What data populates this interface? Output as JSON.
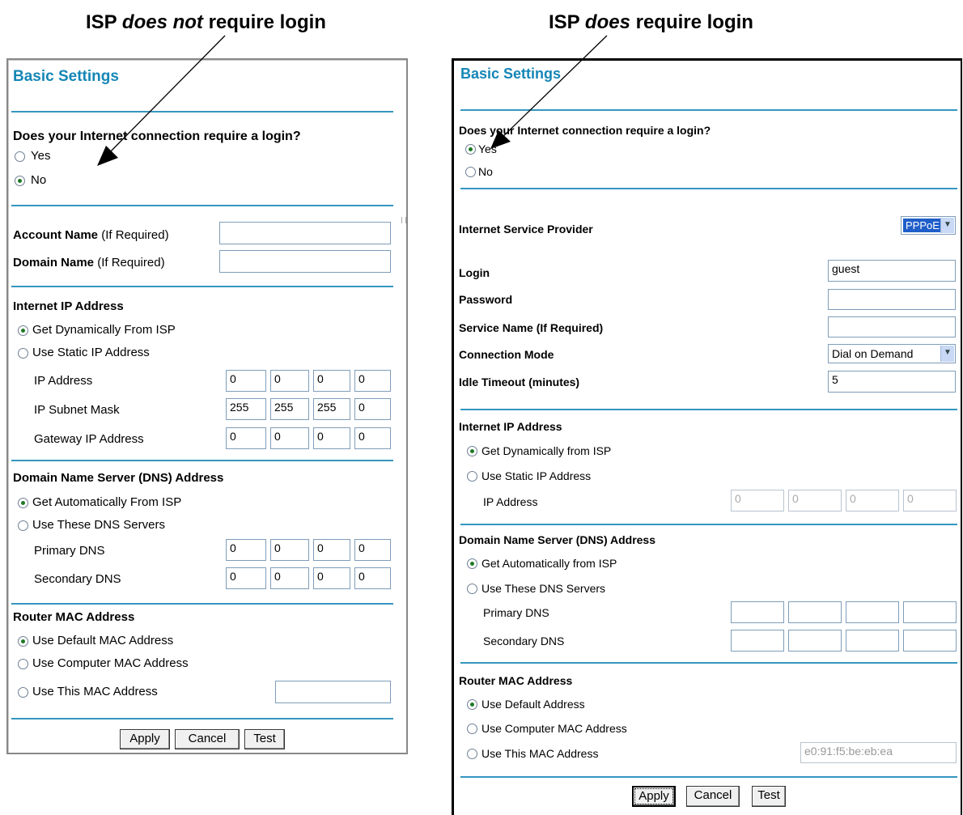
{
  "headings": {
    "left": {
      "pre": "ISP ",
      "em": "does not",
      "post": " require login"
    },
    "right": {
      "pre": "ISP ",
      "em": "does",
      "post": " require login"
    }
  },
  "left_panel": {
    "title": "Basic Settings",
    "login_question": "Does your Internet connection require a login?",
    "yes_label": "Yes",
    "no_label": "No",
    "login_selected": "No",
    "account_name": {
      "bold": "Account Name",
      "note": " (If Required)",
      "value": ""
    },
    "domain_name": {
      "bold": "Domain Name",
      "note": " (If Required)",
      "value": ""
    },
    "internet_ip": {
      "title": "Internet IP Address",
      "opt_dynamic": "Get Dynamically From ISP",
      "opt_static": "Use Static IP Address",
      "selected": "dynamic",
      "ip_label": "IP Address",
      "ip": [
        "0",
        "0",
        "0",
        "0"
      ],
      "mask_label": "IP Subnet Mask",
      "mask": [
        "255",
        "255",
        "255",
        "0"
      ],
      "gateway_label": "Gateway IP Address",
      "gateway": [
        "0",
        "0",
        "0",
        "0"
      ]
    },
    "dns": {
      "title": "Domain Name Server (DNS) Address",
      "opt_auto": "Get Automatically From ISP",
      "opt_manual": "Use These DNS Servers",
      "selected": "auto",
      "primary_label": "Primary DNS",
      "primary": [
        "0",
        "0",
        "0",
        "0"
      ],
      "secondary_label": "Secondary DNS",
      "secondary": [
        "0",
        "0",
        "0",
        "0"
      ]
    },
    "mac": {
      "title": "Router MAC Address",
      "opt_default": "Use Default MAC Address",
      "opt_computer": "Use Computer MAC Address",
      "opt_this": "Use This MAC Address",
      "selected": "default",
      "value": ""
    },
    "buttons": {
      "apply": "Apply",
      "cancel": "Cancel",
      "test": "Test"
    }
  },
  "right_panel": {
    "title": "Basic Settings",
    "login_question": "Does your Internet connection require a login?",
    "yes_label": "Yes",
    "no_label": "No",
    "login_selected": "Yes",
    "isp_label": "Internet Service Provider",
    "isp_value": "PPPoE",
    "login_label": "Login",
    "login_value": "guest",
    "password_label": "Password",
    "password_value": "",
    "service_label": "Service Name (If Required)",
    "service_value": "",
    "conn_mode_label": "Connection Mode",
    "conn_mode_value": "Dial on Demand",
    "idle_label": "Idle Timeout (minutes)",
    "idle_value": "5",
    "internet_ip": {
      "title": "Internet IP Address",
      "opt_dynamic": "Get Dynamically from ISP",
      "opt_static": "Use Static IP Address",
      "selected": "dynamic",
      "ip_label": "IP Address",
      "ip": [
        "0",
        "0",
        "0",
        "0"
      ]
    },
    "dns": {
      "title": "Domain Name Server (DNS) Address",
      "opt_auto": "Get Automatically from ISP",
      "opt_manual": "Use These DNS Servers",
      "selected": "auto",
      "primary_label": "Primary DNS",
      "primary": [
        "",
        "",
        "",
        ""
      ],
      "secondary_label": "Secondary DNS",
      "secondary": [
        "",
        "",
        "",
        ""
      ]
    },
    "mac": {
      "title": "Router MAC Address",
      "opt_default": "Use Default Address",
      "opt_computer": "Use Computer MAC Address",
      "opt_this": "Use This MAC Address",
      "selected": "default",
      "value": "e0:91:f5:be:eb:ea"
    },
    "buttons": {
      "apply": "Apply",
      "cancel": "Cancel",
      "test": "Test"
    }
  },
  "colors": {
    "title": "#1586b6",
    "rule": "#3596bf",
    "radio_dot": "#1d7a25",
    "select_highlight": "#1f5ec9"
  }
}
